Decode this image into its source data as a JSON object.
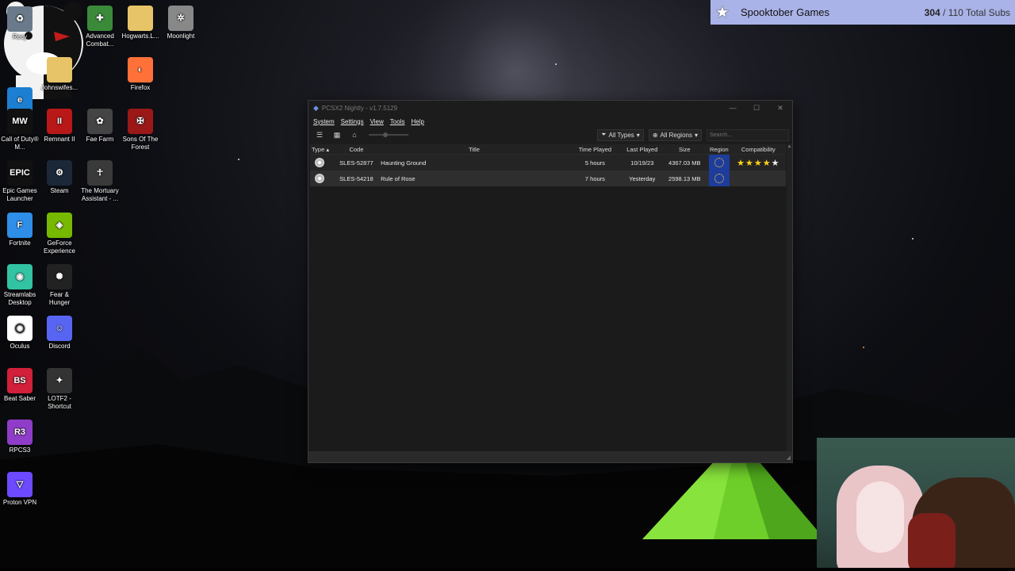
{
  "desktop": {
    "icons": [
      {
        "label": "Recy",
        "icon": "recycle-bin-icon",
        "color": "#6a7a8a"
      },
      {
        "label": "Edge",
        "icon": "edge-icon",
        "color": "#1d7fd1"
      },
      {
        "label": "Call of Duty® M...",
        "icon": "mw-warzone-icon",
        "color": "#111111"
      },
      {
        "label": "Epic Games Launcher",
        "icon": "epic-games-icon",
        "color": "#111111"
      },
      {
        "label": "Fortnite",
        "icon": "fortnite-icon",
        "color": "#2e8ee8"
      },
      {
        "label": "Streamlabs Desktop",
        "icon": "streamlabs-icon",
        "color": "#31c3a2"
      },
      {
        "label": "Oculus",
        "icon": "oculus-icon",
        "color": "#ffffff"
      },
      {
        "label": "Beat Saber",
        "icon": "beat-saber-icon",
        "color": "#d2203a"
      },
      {
        "label": "RPCS3",
        "icon": "rpcs3-icon",
        "color": "#8f3cc8"
      },
      {
        "label": "Proton VPN",
        "icon": "proton-vpn-icon",
        "color": "#6d4aff"
      },
      {
        "label": "Johnswifes...",
        "icon": "folder-icon",
        "color": "#e8c468"
      },
      {
        "label": "Remnant II",
        "icon": "remnant-icon",
        "color": "#b81818"
      },
      {
        "label": "Steam",
        "icon": "steam-icon",
        "color": "#1b2838"
      },
      {
        "label": "GeForce Experience",
        "icon": "geforce-icon",
        "color": "#76b900"
      },
      {
        "label": "Fear & Hunger",
        "icon": "fear-hunger-icon",
        "color": "#222222"
      },
      {
        "label": "Discord",
        "icon": "discord-icon",
        "color": "#5865f2"
      },
      {
        "label": "LOTF2 - Shortcut",
        "icon": "lotf2-icon",
        "color": "#333333"
      },
      {
        "label": "Advanced Combat...",
        "icon": "advanced-combat-icon",
        "color": "#3a8a3a"
      },
      {
        "label": "Fae Farm",
        "icon": "fae-farm-icon",
        "color": "#444444"
      },
      {
        "label": "The Mortuary Assistant - ...",
        "icon": "mortuary-icon",
        "color": "#3a3a3a"
      },
      {
        "label": "Hogwarts.L...",
        "icon": "folder-icon",
        "color": "#e8c468"
      },
      {
        "label": "Firefox",
        "icon": "firefox-icon",
        "color": "#ff7139"
      },
      {
        "label": "Sons Of The Forest",
        "icon": "sons-forest-icon",
        "color": "#9a1818"
      },
      {
        "label": "Moonlight",
        "icon": "moonlight-icon",
        "color": "#888888"
      }
    ]
  },
  "banner": {
    "title": "Spooktober Games",
    "current": "304",
    "suffix": "/ 110 Total Subs",
    "color": "#aab3e8"
  },
  "window": {
    "title": "PCSX2 Nightly - v1.7.5129",
    "menu": [
      "System",
      "Settings",
      "View",
      "Tools",
      "Help"
    ],
    "filters": {
      "types": "All Types",
      "regions": "All Regions",
      "search_placeholder": "Search..."
    },
    "columns": {
      "type": "Type",
      "code": "Code",
      "title": "Title",
      "time_played": "Time Played",
      "last_played": "Last Played",
      "size": "Size",
      "region": "Region",
      "compatibility": "Compatibility"
    },
    "games": [
      {
        "code": "SLES-52877",
        "title": "Haunting Ground",
        "time_played": "5 hours",
        "last_played": "10/19/23",
        "size": "4367.03 MB",
        "region": "Europe",
        "stars": 5
      },
      {
        "code": "SLES-54218",
        "title": "Rule of Rose",
        "time_played": "7 hours",
        "last_played": "Yesterday",
        "size": "2598.13 MB",
        "region": "Europe",
        "stars": 0
      }
    ]
  }
}
